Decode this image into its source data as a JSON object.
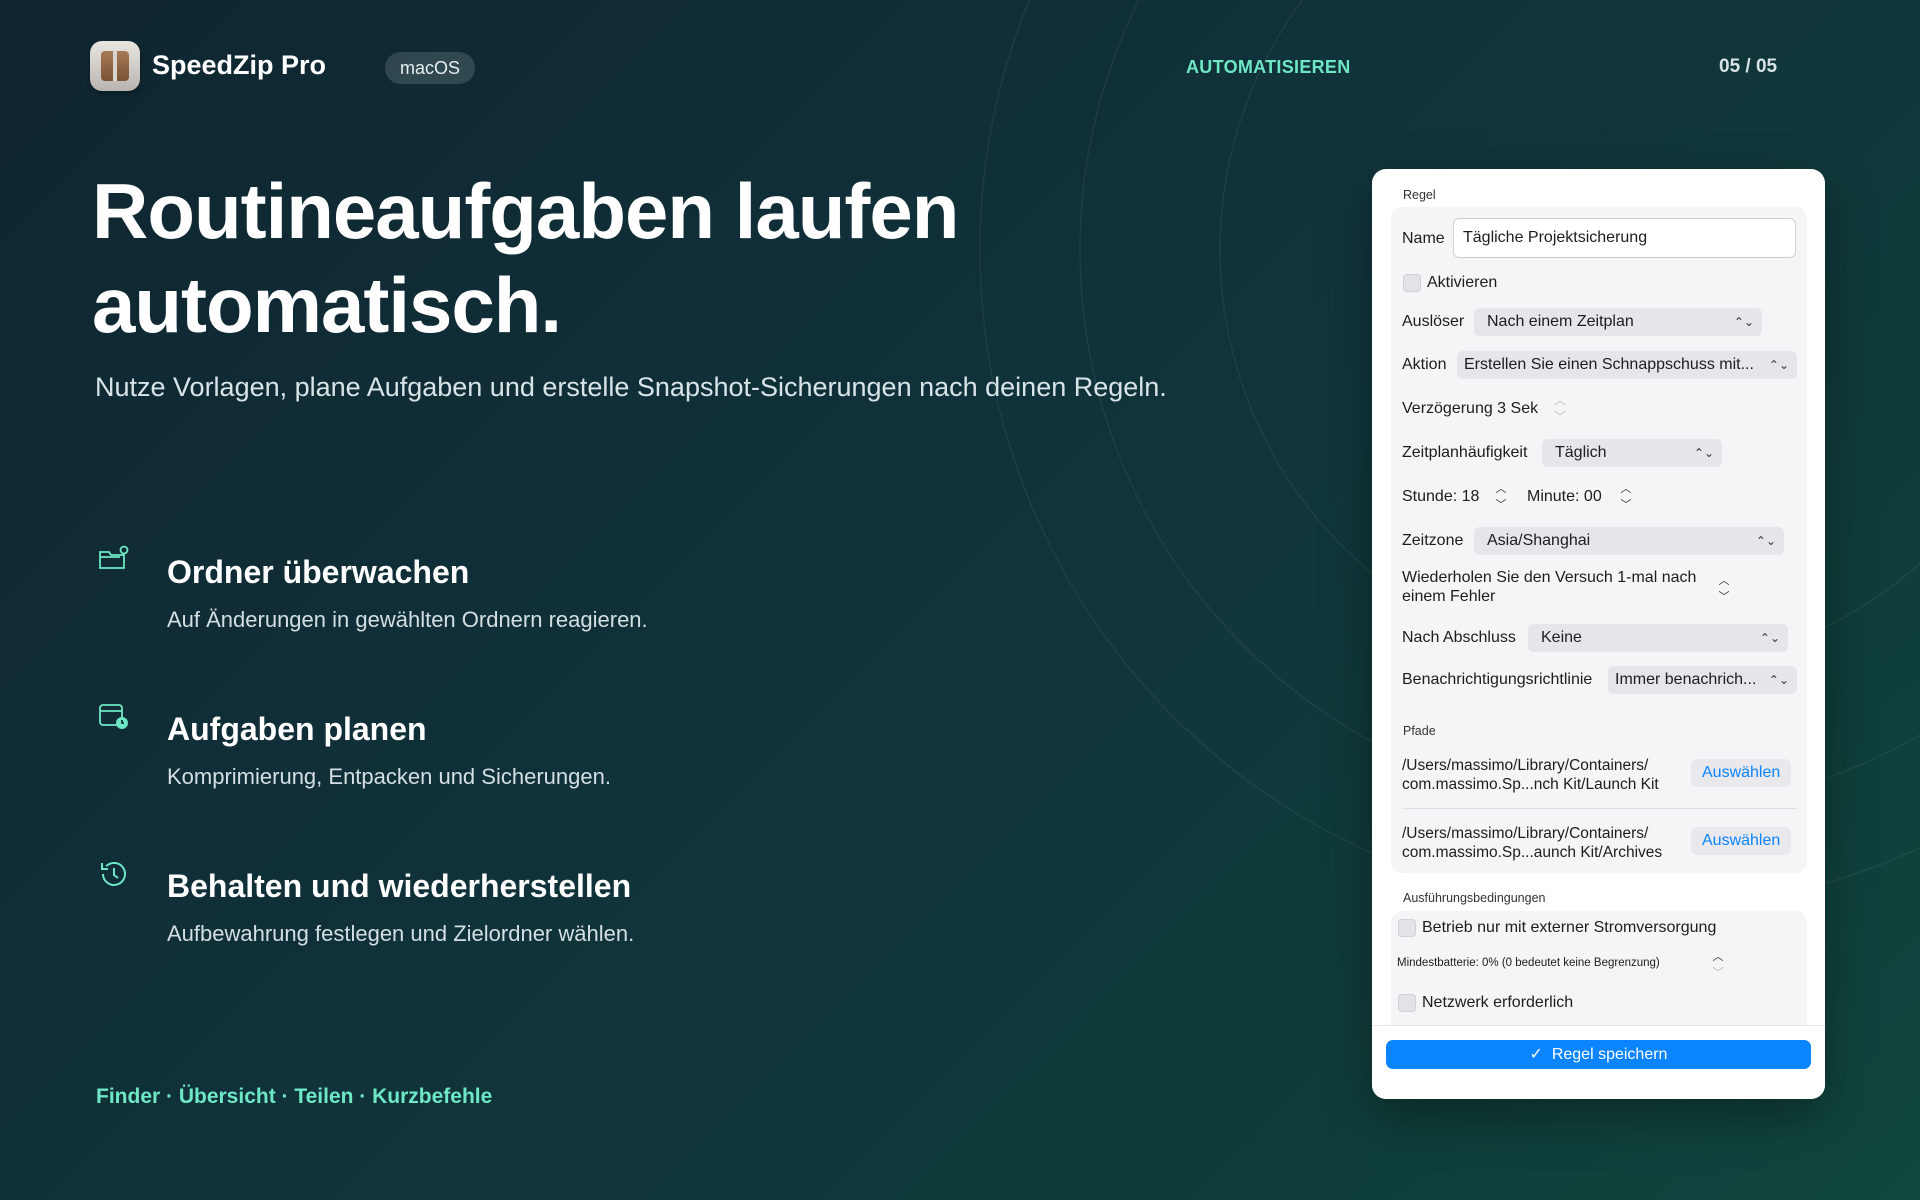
{
  "app": {
    "name": "SpeedZip Pro",
    "platform": "macOS",
    "icon": "archive-box-icon"
  },
  "header": {
    "section": "AUTOMATISIEREN",
    "page_counter": "05 / 05"
  },
  "hero": {
    "headline": "Routineaufgaben laufen automatisch.",
    "subhead": "Nutze Vorlagen, plane Aufgaben und erstelle Snapshot-Sicherungen nach deinen Regeln."
  },
  "features": [
    {
      "icon": "folder-gear-icon",
      "title": "Ordner überwachen",
      "desc": "Auf Änderungen in gewählten Ordnern reagieren."
    },
    {
      "icon": "calendar-clock-icon",
      "title": "Aufgaben planen",
      "desc": "Komprimierung, Entpacken und Sicherungen."
    },
    {
      "icon": "history-icon",
      "title": "Behalten und wiederherstellen",
      "desc": "Aufbewahrung festlegen und Zielordner wählen."
    }
  ],
  "footer": {
    "links": "Finder · Übersicht · Teilen · Kurzbefehle"
  },
  "panel": {
    "rule_section": "Regel",
    "name_label": "Name",
    "name_value": "Tägliche Projektsicherung",
    "enable_label": "Aktivieren",
    "trigger_label": "Auslöser",
    "trigger_value": "Nach einem Zeitplan",
    "action_label": "Aktion",
    "action_value": "Erstellen Sie einen Schnappschuss mit...",
    "delay_label": "Verzögerung 3 Sek",
    "frequency_label": "Zeitplanhäufigkeit",
    "frequency_value": "Täglich",
    "hour_label": "Stunde: 18",
    "minute_label": "Minute: 00",
    "timezone_label": "Zeitzone",
    "timezone_value": "Asia/Shanghai",
    "retry_label_line1": "Wiederholen Sie den Versuch 1-mal nach",
    "retry_label_line2": "einem Fehler",
    "after_label": "Nach Abschluss",
    "after_value": "Keine",
    "notify_label": "Benachrichtigungsrichtlinie",
    "notify_value": "Immer benachrich...",
    "paths_section": "Pfade",
    "paths": [
      {
        "line1": "/Users/massimo/Library/Containers/",
        "line2": "com.massimo.Sp...nch Kit/Launch Kit",
        "button": "Auswählen"
      },
      {
        "line1": "/Users/massimo/Library/Containers/",
        "line2": "com.massimo.Sp...aunch Kit/Archives",
        "button": "Auswählen"
      }
    ],
    "conditions_section": "Ausführungsbedingungen",
    "power_label": "Betrieb nur mit externer Stromversorgung",
    "battery_label": "Mindestbatterie: 0% (0 bedeutet keine Begrenzung)",
    "network_label": "Netzwerk erforderlich",
    "save_label": "Regel speichern"
  },
  "colors": {
    "accent": "#6ee7c5",
    "button_blue": "#0a84ff",
    "bg_dark": "#0f2530",
    "bg_teal": "#10463e"
  }
}
